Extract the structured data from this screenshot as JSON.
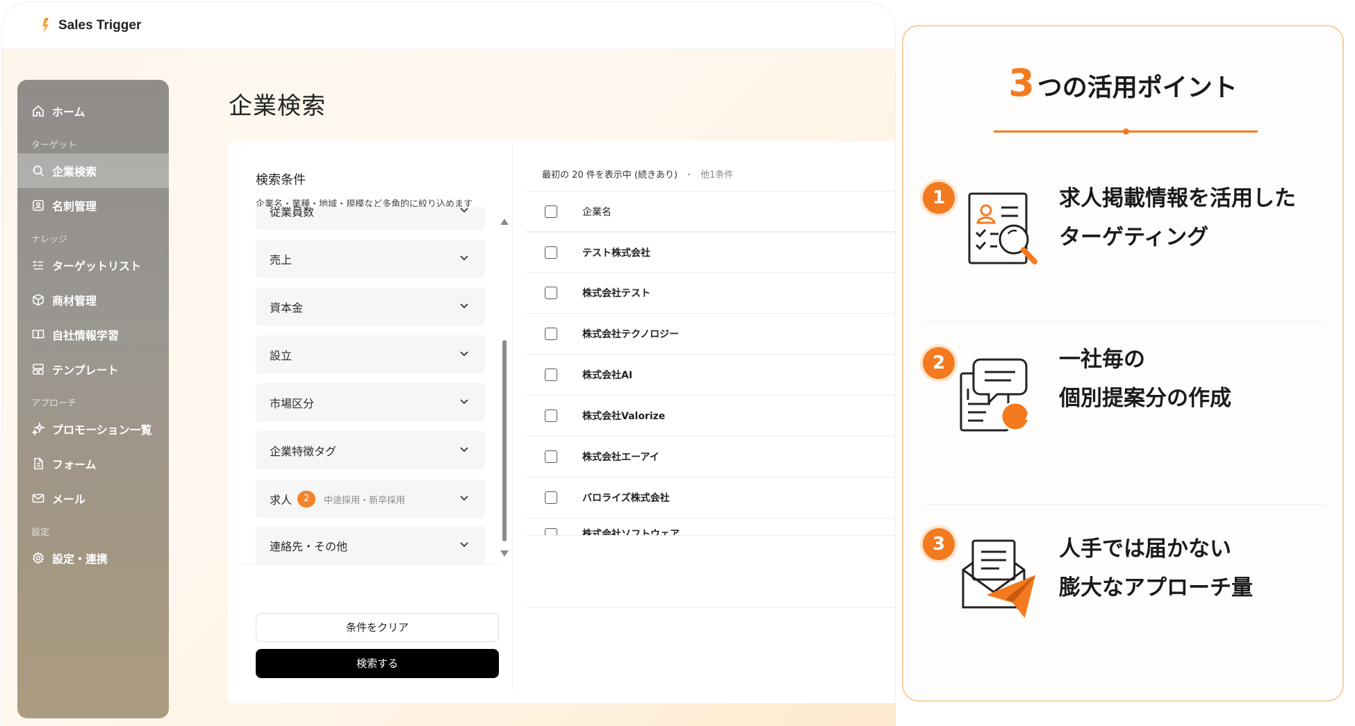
{
  "app": {
    "name": "Sales Trigger",
    "page_title": "企業検索"
  },
  "sidebar": {
    "home": "ホーム",
    "section_target": "ターゲット",
    "company_search": "企業検索",
    "business_cards": "名刺管理",
    "section_knowledge": "ナレッジ",
    "target_list": "ターゲットリスト",
    "product_mgmt": "商材管理",
    "company_learning": "自社情報学習",
    "templates": "テンプレート",
    "section_approach": "アプローチ",
    "promotions": "プロモーション一覧",
    "forms": "フォーム",
    "mail": "メール",
    "section_settings": "設定",
    "settings_integrations": "設定・連携"
  },
  "filters": {
    "title": "検索条件",
    "subtitle": "企業名・業種・地域・規模など多角的に絞り込めます",
    "items": [
      {
        "label": "従業員数"
      },
      {
        "label": "売上"
      },
      {
        "label": "資本金"
      },
      {
        "label": "設立"
      },
      {
        "label": "市場区分"
      },
      {
        "label": "企業特徴タグ"
      },
      {
        "label": "求人",
        "badge": "2",
        "hint": "中途採用・新卒採用"
      },
      {
        "label": "連絡先・その他"
      }
    ],
    "clear_label": "条件をクリア",
    "search_label": "検索する"
  },
  "results": {
    "status": "最初の 20 件を表示中 (続きあり)",
    "separator": "・",
    "extra": "他1条件",
    "column_company": "企業名",
    "rows": [
      "テスト株式会社",
      "株式会社テスト",
      "株式会社テクノロジー",
      "株式会社AI",
      "株式会社Valorize",
      "株式会社エーアイ",
      "バロライズ株式会社",
      "株式会社ソフトウェア"
    ]
  },
  "panel": {
    "title_num": "3",
    "title_text": "つの活用ポイント",
    "points": [
      {
        "num": "1",
        "line1": "求人掲載情報を活用した",
        "line2": "ターゲティング",
        "icon": "document-search-icon"
      },
      {
        "num": "2",
        "line1": "一社毎の",
        "line2": "個別提案分の作成",
        "icon": "ai-document-chat-icon"
      },
      {
        "num": "3",
        "line1": "人手では届かない",
        "line2": "膨大なアプローチ量",
        "icon": "mail-send-icon"
      }
    ]
  },
  "colors": {
    "accent": "#f47a1f",
    "sidebar": "#9a9690",
    "primary_button": "#000000"
  }
}
